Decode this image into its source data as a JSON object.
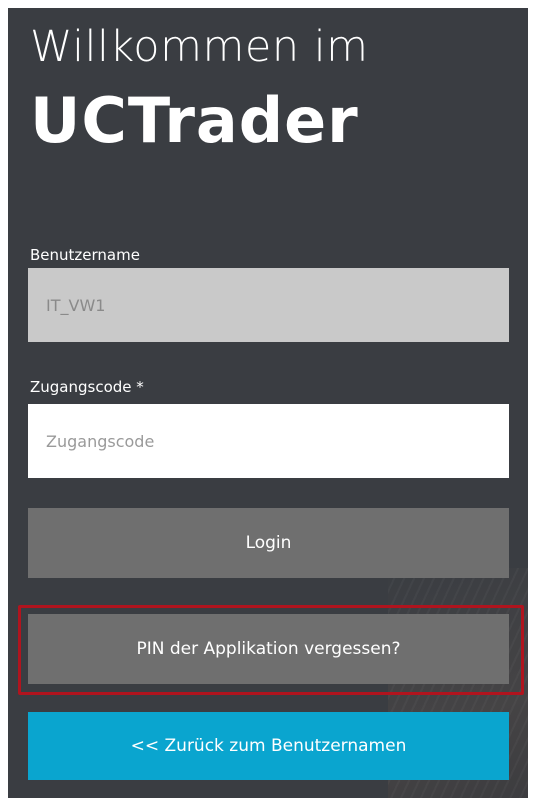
{
  "header": {
    "welcome": "Willkommen im",
    "brand": "UCTrader"
  },
  "form": {
    "username_label": "Benutzername",
    "username_value": "IT_VW1",
    "code_label": "Zugangscode *",
    "code_placeholder": "Zugangscode",
    "code_value": ""
  },
  "buttons": {
    "login": "Login",
    "forgot_pin": "PIN der Applikation vergessen?",
    "back": "<< Zurück zum Benutzernamen"
  },
  "colors": {
    "panel_bg": "#3a3d42",
    "button_gray": "#6f6f6f",
    "accent_blue": "#0aa5cf",
    "highlight_red": "#b0141e"
  }
}
